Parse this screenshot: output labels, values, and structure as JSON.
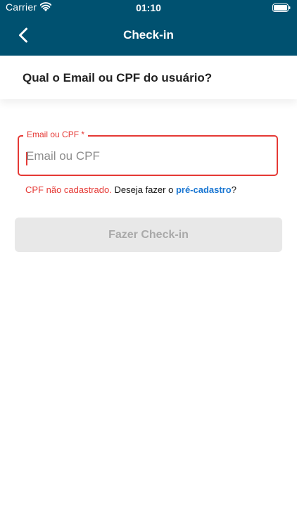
{
  "status_bar": {
    "carrier": "Carrier",
    "time": "01:10",
    "wifi_icon": "wifi-icon",
    "battery_icon": "battery-icon"
  },
  "nav": {
    "title": "Check-in",
    "back_icon": "chevron-left-icon"
  },
  "question": "Qual o Email ou CPF do usuário?",
  "field": {
    "label": "Email ou CPF *",
    "placeholder": "Email ou CPF",
    "value": ""
  },
  "error": {
    "message": "CPF não cadastrado.",
    "prompt": "Deseja fazer o",
    "link": "pré-cadastro",
    "suffix": "?"
  },
  "checkin_button": {
    "label": "Fazer Check-in",
    "enabled": false
  },
  "colors": {
    "header": "#005170",
    "error": "#e53935",
    "link": "#1976d2",
    "button_disabled": "#e8e8e8"
  }
}
